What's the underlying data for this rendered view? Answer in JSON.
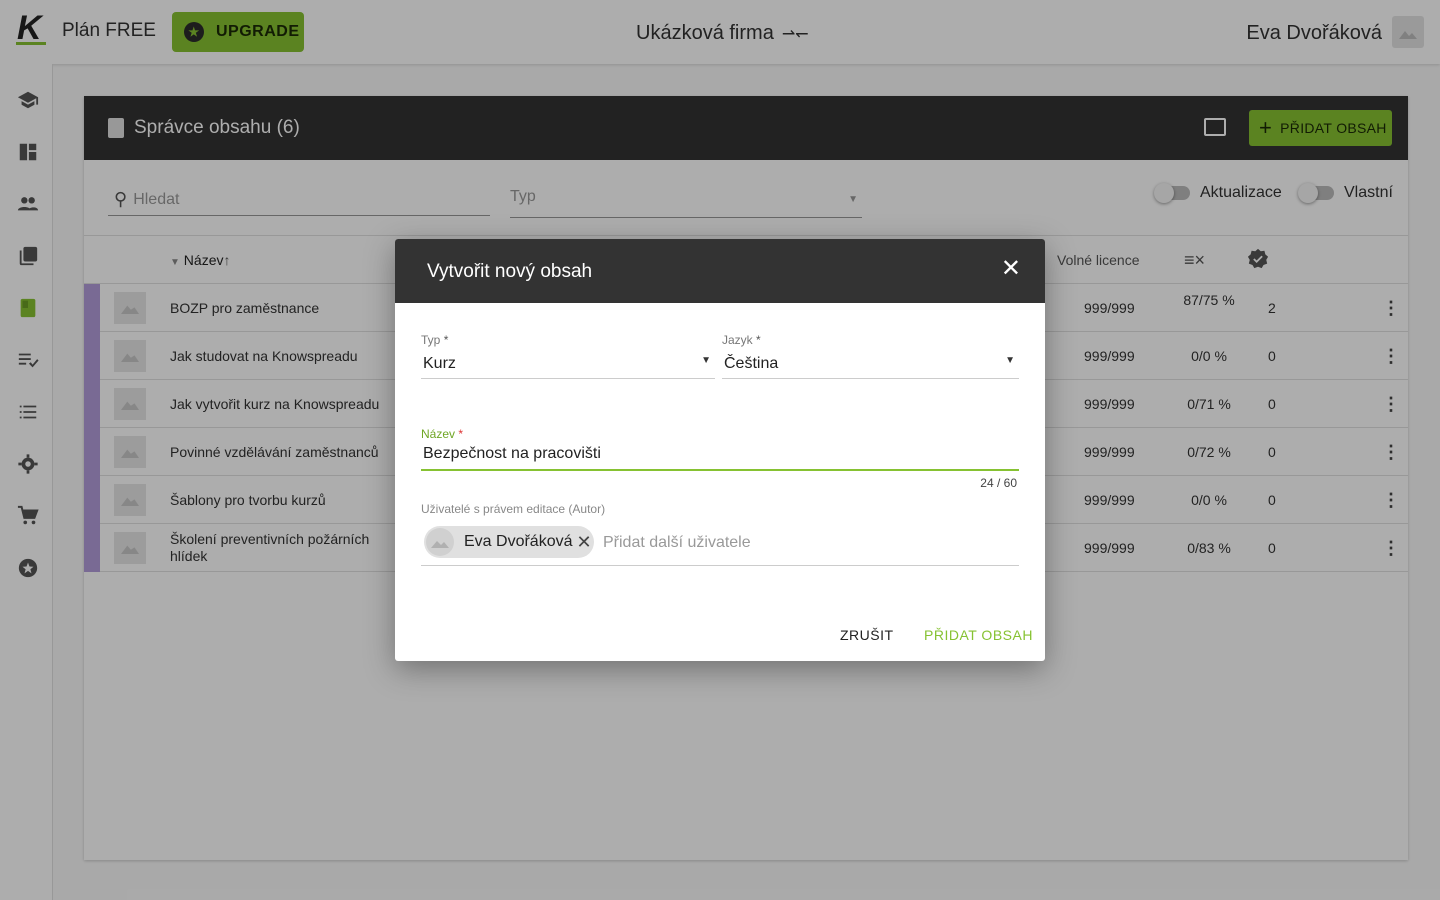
{
  "topbar": {
    "logo_letter": "K",
    "plan": "Plán FREE",
    "upgrade_label": "UPGRADE",
    "company": "Ukázková firma",
    "user_name": "Eva Dvořáková"
  },
  "sidebar": {
    "items": [
      {
        "icon": "school-icon"
      },
      {
        "icon": "dashboard-icon"
      },
      {
        "icon": "people-icon"
      },
      {
        "icon": "library-icon"
      },
      {
        "icon": "book-icon",
        "active": true
      },
      {
        "icon": "playlist-check-icon"
      },
      {
        "icon": "list-icon"
      },
      {
        "icon": "gear-icon"
      },
      {
        "icon": "cart-icon"
      },
      {
        "icon": "star-icon"
      }
    ]
  },
  "manager": {
    "title": "Správce obsahu (6)",
    "add_label": "PŘIDAT OBSAH",
    "search_placeholder": "Hledat",
    "type_placeholder": "Typ",
    "toggle_updates": "Aktualizace",
    "toggle_own": "Vlastní",
    "col_name": "Název",
    "col_licenses": "Volné licence"
  },
  "rows": [
    {
      "name": "BOZP pro zaměstnance",
      "licenses": "999/999",
      "pct": "87/75 %",
      "count": "2"
    },
    {
      "name": "Jak studovat na Knowspreadu",
      "licenses": "999/999",
      "pct": "0/0 %",
      "count": "0"
    },
    {
      "name": "Jak vytvořit kurz na Knowspreadu",
      "licenses": "999/999",
      "pct": "0/71 %",
      "count": "0"
    },
    {
      "name": "Povinné vzdělávání zaměstnanců",
      "licenses": "999/999",
      "pct": "0/72 %",
      "count": "0"
    },
    {
      "name": "Šablony pro tvorbu kurzů",
      "licenses": "999/999",
      "pct": "0/0 %",
      "count": "0"
    },
    {
      "name": "Školení preventivních požárních hlídek",
      "licenses": "999/999",
      "pct": "0/83 %",
      "count": "0"
    }
  ],
  "dialog": {
    "title": "Vytvořit nový obsah",
    "type_label": "Typ",
    "type_value": "Kurz",
    "lang_label": "Jazyk",
    "lang_value": "Čeština",
    "name_label": "Název",
    "name_value": "Bezpečnost na pracovišti",
    "counter": "24 / 60",
    "authors_label": "Uživatelé s právem editace (Autor)",
    "author_chip": "Eva Dvořáková",
    "add_users_placeholder": "Přidat další uživatele",
    "cancel_label": "ZRUŠIT",
    "submit_label": "PŘIDAT OBSAH",
    "required_mark": "*"
  },
  "colors": {
    "accent": "#86c232",
    "header_dark": "#333333",
    "row_marker": "#b39ddb"
  }
}
